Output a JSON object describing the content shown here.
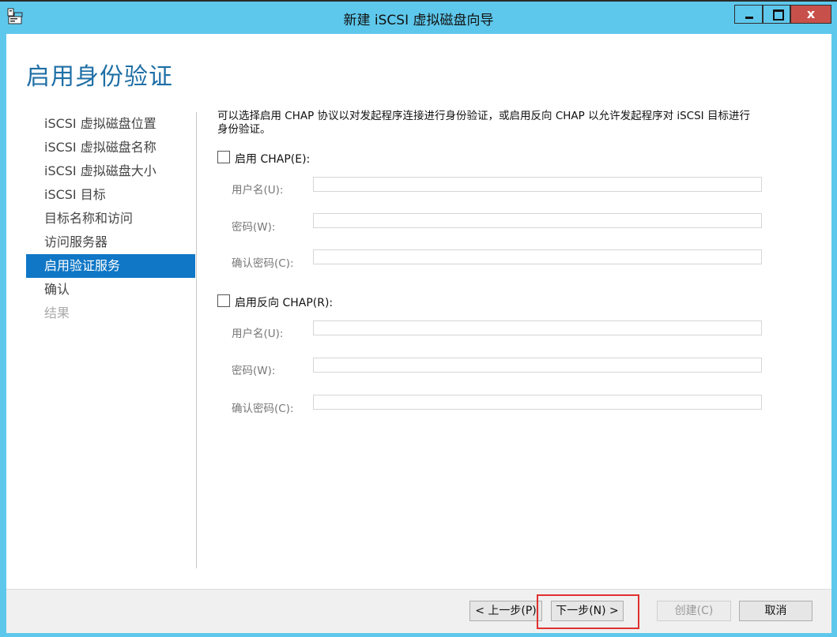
{
  "window": {
    "title": "新建 iSCSI 虚拟磁盘向导",
    "close_label": "x"
  },
  "page": {
    "title": "启用身份验证"
  },
  "nav": {
    "items": [
      {
        "label": "iSCSI 虚拟磁盘位置",
        "state": "normal"
      },
      {
        "label": "iSCSI 虚拟磁盘名称",
        "state": "normal"
      },
      {
        "label": "iSCSI 虚拟磁盘大小",
        "state": "normal"
      },
      {
        "label": "iSCSI 目标",
        "state": "normal"
      },
      {
        "label": "目标名称和访问",
        "state": "normal"
      },
      {
        "label": "访问服务器",
        "state": "normal"
      },
      {
        "label": "启用验证服务",
        "state": "active"
      },
      {
        "label": "确认",
        "state": "normal"
      },
      {
        "label": "结果",
        "state": "disabled"
      }
    ]
  },
  "main": {
    "description_line1": "可以选择启用 CHAP 协议以对发起程序连接进行身份验证，或启用反向 CHAP 以允许发起程序对 iSCSI 目标进行",
    "description_line2": "身份验证。",
    "chap": {
      "checkbox_label": "启用 CHAP(E):",
      "checked": false,
      "username_label": "用户名(U):",
      "username_value": "",
      "password_label": "密码(W):",
      "password_value": "",
      "confirm_label": "确认密码(C):",
      "confirm_value": ""
    },
    "reverse_chap": {
      "checkbox_label": "启用反向 CHAP(R):",
      "checked": false,
      "username_label": "用户名(U):",
      "username_value": "",
      "password_label": "密码(W):",
      "password_value": "",
      "confirm_label": "确认密码(C):",
      "confirm_value": ""
    }
  },
  "footer": {
    "prev_label": "< 上一步(P)",
    "next_label": "下一步(N) >",
    "create_label": "创建(C)",
    "cancel_label": "取消"
  },
  "colors": {
    "frame": "#5ec8ec",
    "accent": "#0f77c6",
    "title": "#1f6fa6",
    "close": "#c7504b",
    "highlight": "#e03030"
  }
}
